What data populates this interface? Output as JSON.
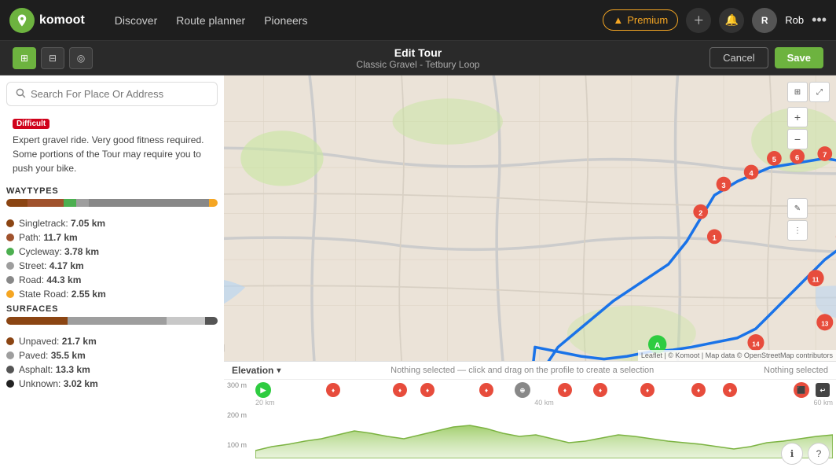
{
  "nav": {
    "logo_text": "komoot",
    "links": [
      "Discover",
      "Route planner",
      "Pioneers"
    ],
    "premium_label": "Premium",
    "user_name": "Rob"
  },
  "edit_header": {
    "title": "Edit Tour",
    "subtitle": "Classic Gravel - Tetbury Loop",
    "cancel_label": "Cancel",
    "save_label": "Save"
  },
  "search": {
    "placeholder": "Search For Place Or Address"
  },
  "description": {
    "difficulty": "Difficult",
    "text": "Expert gravel ride. Very good fitness required. Some portions of the Tour may require you to push your bike."
  },
  "waytypes": {
    "title": "WAYTYPES",
    "items": [
      {
        "label": "Singletrack:",
        "value": "7.05 km",
        "color": "#8b4513"
      },
      {
        "label": "Path:",
        "value": "11.7 km",
        "color": "#a0522d"
      },
      {
        "label": "Cycleway:",
        "value": "3.78 km",
        "color": "#4caf50"
      },
      {
        "label": "Street:",
        "value": "4.17 km",
        "color": "#9e9e9e"
      },
      {
        "label": "Road:",
        "value": "44.3 km",
        "color": "#888"
      },
      {
        "label": "State Road:",
        "value": "2.55 km",
        "color": "#f5a623"
      }
    ]
  },
  "surfaces": {
    "title": "SURFACES",
    "items": [
      {
        "label": "Unpaved:",
        "value": "21.7 km",
        "color": "#8b4513"
      },
      {
        "label": "Paved:",
        "value": "35.5 km",
        "color": "#9e9e9e"
      },
      {
        "label": "Asphalt:",
        "value": "13.3 km",
        "color": "#555"
      },
      {
        "label": "Unknown:",
        "value": "3.02 km",
        "color": "#222"
      }
    ]
  },
  "elevation": {
    "title": "Elevation",
    "distance_labels": [
      "20 km",
      "40 km",
      "60 km"
    ],
    "y_labels": [
      "300 m",
      "200 m",
      "100 m"
    ],
    "nothing_selected": "Nothing selected — click and drag on the profile to create a selection",
    "nothing_selected_right": "Nothing selected"
  },
  "map_attribution": "Leaflet | © Komoot | Map data © OpenStreetMap contributors"
}
